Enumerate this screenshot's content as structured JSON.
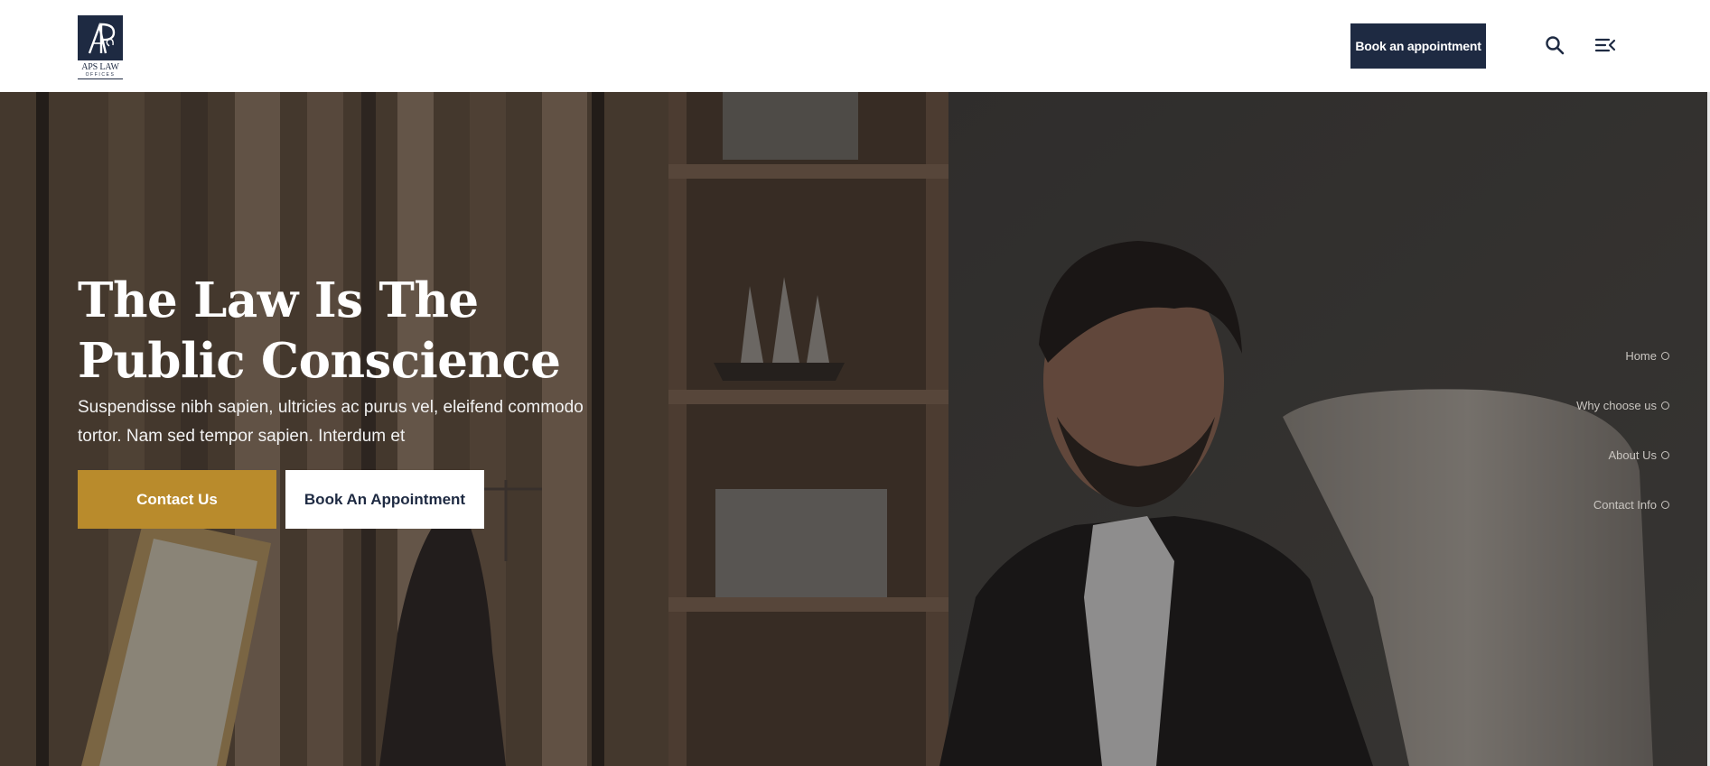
{
  "brand": {
    "logo_monogram": "AP",
    "name": "APS LAW",
    "tagline": "OFFICES"
  },
  "header": {
    "book_button": "Book an appointment",
    "search_icon": "search-icon",
    "menu_icon": "menu-icon"
  },
  "hero": {
    "title": "The Law Is The Public Conscience",
    "text": "Suspendisse nibh sapien, ultricies ac purus vel, eleifend commodo tortor. Nam sed tempor sapien. Interdum et",
    "primary_button": "Contact Us",
    "secondary_button": "Book An Appointment"
  },
  "side_nav": {
    "items": [
      {
        "label": "Home"
      },
      {
        "label": "Why choose us"
      },
      {
        "label": "About Us"
      },
      {
        "label": "Contact Info"
      }
    ]
  },
  "colors": {
    "navy": "#1e2a42",
    "gold": "#b98b2c",
    "white": "#ffffff"
  }
}
